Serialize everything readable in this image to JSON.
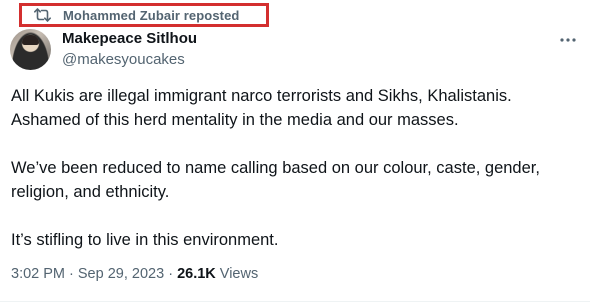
{
  "repost": {
    "icon": "repost-icon",
    "text": "Mohammed Zubair reposted",
    "highlight_color": "#d32f2f"
  },
  "author": {
    "display_name": "Makepeace Sitlhou",
    "handle": "@makesyoucakes",
    "avatar_icon": "avatar"
  },
  "more_icon": "more-horizontal-icon",
  "body": {
    "paragraphs": [
      "All Kukis are illegal immigrant narco terrorists and Sikhs, Khalistanis. Ashamed of this herd mentality in the media and our masses.",
      "We’ve been reduced to name calling based on our colour, caste, gender, religion, and ethnicity.",
      "It’s stifling to live in this environment."
    ]
  },
  "meta": {
    "time": "3:02 PM",
    "separator1": " · ",
    "date": "Sep 29, 2023",
    "separator2": " · ",
    "views_count": "26.1K",
    "views_label": " Views"
  },
  "colors": {
    "text_primary": "#0f1419",
    "text_secondary": "#536471",
    "background": "#ffffff"
  }
}
